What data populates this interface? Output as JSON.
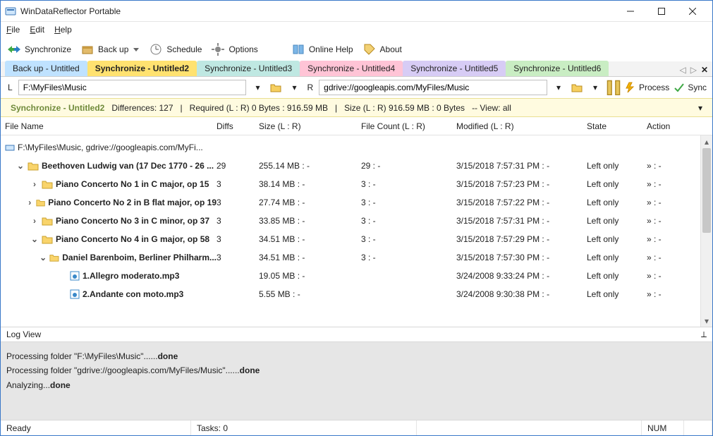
{
  "window": {
    "title": "WinDataReflector Portable"
  },
  "menu": {
    "file": "File",
    "edit": "Edit",
    "help": "Help"
  },
  "toolbar": {
    "synchronize": "Synchronize",
    "backup": "Back up",
    "schedule": "Schedule",
    "options": "Options",
    "onlinehelp": "Online Help",
    "about": "About"
  },
  "tabs": [
    {
      "label": "Back up - Untitled",
      "kind": "blue"
    },
    {
      "label": "Synchronize - Untitled2",
      "kind": "yellow"
    },
    {
      "label": "Synchronize - Untitled3",
      "kind": "teal"
    },
    {
      "label": "Synchronize - Untitled4",
      "kind": "pink"
    },
    {
      "label": "Synchronize - Untitled5",
      "kind": "violet"
    },
    {
      "label": "Synchronize - Untitled6",
      "kind": "green"
    }
  ],
  "paths": {
    "l_label": "L",
    "r_label": "R",
    "left": "F:\\MyFiles\\Music",
    "right": "gdrive://googleapis.com/MyFiles/Music",
    "process": "Process",
    "sync": "Sync"
  },
  "status": {
    "name": "Synchronize - Untitled2",
    "diffs": "Differences: 127",
    "required": "Required (L : R)   0 Bytes : 916.59 MB",
    "size": "Size (L : R)    916.59 MB : 0 Bytes",
    "view": "-- View: all"
  },
  "columns": {
    "name": "File Name",
    "diffs": "Diffs",
    "size": "Size (L : R)",
    "count": "File Count (L : R)",
    "modified": "Modified (L : R)",
    "state": "State",
    "action": "Action"
  },
  "root_path": "F:\\MyFiles\\Music, gdrive://googleapis.com/MyFi...",
  "rows": [
    {
      "indent": 0,
      "exp": "down",
      "kind": "folder",
      "bold": true,
      "name": "Beethoven Ludwig van (17 Dec 1770 - 26 ...",
      "diffs": "29",
      "size": "255.14 MB : -",
      "count": "29 : -",
      "mod": "3/15/2018 7:57:31 PM : -",
      "state": "Left only",
      "act": "» : -"
    },
    {
      "indent": 1,
      "exp": "right",
      "kind": "folder",
      "bold": true,
      "name": "Piano Concerto No 1 in C major, op 15",
      "diffs": "3",
      "size": "38.14 MB : -",
      "count": "3 : -",
      "mod": "3/15/2018 7:57:23 PM : -",
      "state": "Left only",
      "act": "» : -"
    },
    {
      "indent": 1,
      "exp": "right",
      "kind": "folder",
      "bold": true,
      "name": "Piano Concerto No 2 in B flat major, op 19",
      "diffs": "3",
      "size": "27.74 MB : -",
      "count": "3 : -",
      "mod": "3/15/2018 7:57:22 PM : -",
      "state": "Left only",
      "act": "» : -"
    },
    {
      "indent": 1,
      "exp": "right",
      "kind": "folder",
      "bold": true,
      "name": "Piano Concerto No 3 in C minor, op 37",
      "diffs": "3",
      "size": "33.85 MB : -",
      "count": "3 : -",
      "mod": "3/15/2018 7:57:31 PM : -",
      "state": "Left only",
      "act": "» : -"
    },
    {
      "indent": 1,
      "exp": "down",
      "kind": "folder",
      "bold": true,
      "name": "Piano Concerto No 4 in G major, op 58",
      "diffs": "3",
      "size": "34.51 MB : -",
      "count": "3 : -",
      "mod": "3/15/2018 7:57:29 PM : -",
      "state": "Left only",
      "act": "» : -"
    },
    {
      "indent": 2,
      "exp": "down",
      "kind": "folder",
      "bold": true,
      "name": "Daniel Barenboim, Berliner Philharm...",
      "diffs": "3",
      "size": "34.51 MB : -",
      "count": "3 : -",
      "mod": "3/15/2018 7:57:30 PM : -",
      "state": "Left only",
      "act": "» : -"
    },
    {
      "indent": 3,
      "exp": "none",
      "kind": "file",
      "bold": true,
      "name": "1.Allegro moderato.mp3",
      "diffs": "",
      "size": "19.05 MB : -",
      "count": "",
      "mod": "3/24/2008 9:33:24 PM : -",
      "state": "Left only",
      "act": "» : -"
    },
    {
      "indent": 3,
      "exp": "none",
      "kind": "file",
      "bold": true,
      "name": "2.Andante con moto.mp3",
      "diffs": "",
      "size": "5.55 MB : -",
      "count": "",
      "mod": "3/24/2008 9:30:38 PM : -",
      "state": "Left only",
      "act": "» : -"
    }
  ],
  "logview": {
    "title": "Log View",
    "lines": [
      {
        "pre": "Processing folder \"F:\\MyFiles\\Music\"......",
        "bold": "done"
      },
      {
        "pre": "Processing folder \"gdrive://googleapis.com/MyFiles/Music\"......",
        "bold": "done"
      },
      {
        "pre": "Analyzing...",
        "bold": "done"
      }
    ]
  },
  "statusbar": {
    "ready": "Ready",
    "tasks": "Tasks: 0",
    "num": "NUM"
  }
}
